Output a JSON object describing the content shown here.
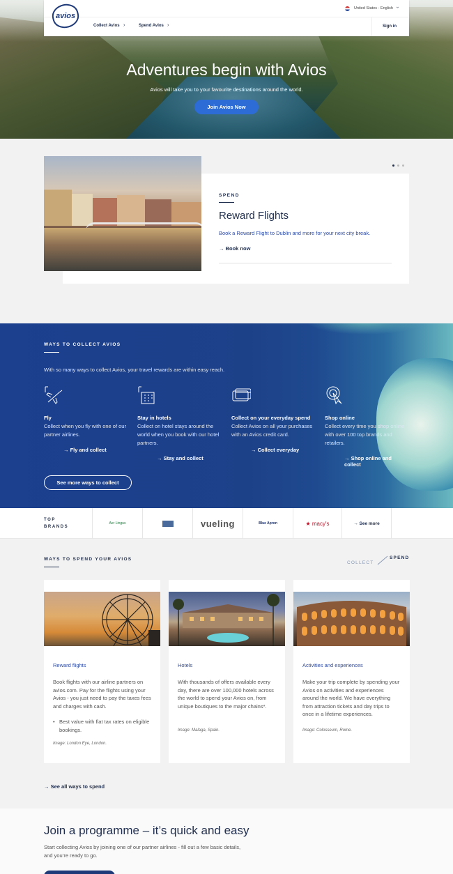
{
  "header": {
    "logo_text": "avios",
    "collect_label": "Collect Avios",
    "spend_label": "Spend Avios",
    "locale": "United States - English",
    "signin": "Sign in"
  },
  "hero": {
    "title": "Adventures begin with Avios",
    "subtitle": "Avios will take you to your favourite destinations around the world.",
    "button": "Join Avios Now"
  },
  "feature": {
    "label": "SPEND",
    "title": "Reward Flights",
    "description": "Book a Reward Flight to Dublin and more for your next city break.",
    "link": "Book now"
  },
  "collect": {
    "label": "WAYS TO COLLECT AVIOS",
    "intro": "With so many ways to collect Avios, your travel rewards are within easy reach.",
    "items": [
      {
        "title": "Fly",
        "desc": "Collect when you fly with one of our partner airlines.",
        "link": "Fly and collect",
        "icon": "plane-icon"
      },
      {
        "title": "Stay in hotels",
        "desc": "Collect on hotel stays around the world when you book with our hotel partners.",
        "link": "Stay and collect",
        "icon": "hotel-icon"
      },
      {
        "title": "Collect on your everyday spend",
        "desc": "Collect Avios on all your purchases with an Avios credit card.",
        "link": "Collect everyday",
        "icon": "credit-card-icon"
      },
      {
        "title": "Shop online",
        "desc": "Collect every time you shop online with over 100 top brands and retailers.",
        "link": "Shop online and collect",
        "icon": "cursor-click-icon"
      }
    ],
    "more_button": "See more ways to collect"
  },
  "brands": {
    "label": "TOP BRANDS",
    "items": [
      "Aer Lingus",
      "British Airways",
      "vueling",
      "Blue Apron",
      "macy's"
    ],
    "more": "See more"
  },
  "spend": {
    "label": "WAYS TO SPEND YOUR AVIOS",
    "toggle_collect": "COLLECT",
    "toggle_spend": "SPEND",
    "cards": [
      {
        "title": "Reward flights",
        "desc": "Book flights with our airline partners on avios.com. Pay for the flights using your Avios - you just need to pay the taxes fees and charges with cash.",
        "bullet": "Best value with flat tax rates on eligible bookings.",
        "caption": "Image: London Eye, London."
      },
      {
        "title": "Hotels",
        "desc": "With thousands of offers available every day, there are over 100,000 hotels across the world to spend your Avios on, from unique boutiques to the major chains*.",
        "caption": "Image: Malaga, Spain."
      },
      {
        "title": "Activities and experiences",
        "desc": "Make your trip complete by spending your Avios on activities and experiences around the world. We have everything from attraction tickets and day trips to once in a lifetime experiences.",
        "caption": "Image: Colosseum, Rome."
      }
    ],
    "see_all": "See all ways to spend"
  },
  "join": {
    "title": "Join a programme – it’s quick and easy",
    "desc": "Start collecting Avios by joining one of our partner airlines - fill out a few basic details, and you’re ready to go."
  },
  "colors": {
    "brand_navy": "#1f3a78",
    "accent_blue": "#2d6cd6",
    "collect_bg": "#1c3f8e"
  }
}
